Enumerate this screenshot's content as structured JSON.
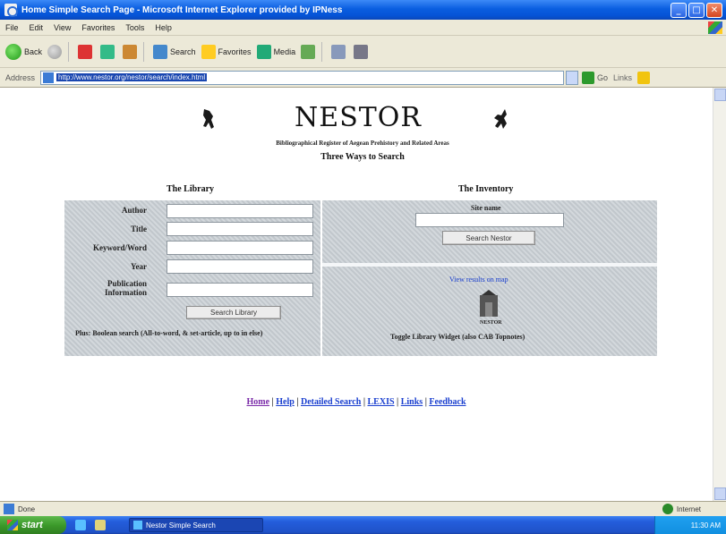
{
  "window": {
    "title": "Home Simple Search Page - Microsoft Internet Explorer provided by IPNess",
    "minimize": "_",
    "maximize": "□",
    "close": "✕"
  },
  "menu": [
    "File",
    "Edit",
    "View",
    "Favorites",
    "Tools",
    "Help"
  ],
  "toolbar": {
    "back": "Back",
    "search": "Search",
    "favorites": "Favorites",
    "media": "Media"
  },
  "address": {
    "label": "Address",
    "url": "http://www.nestor.org/nestor/search/index.html",
    "go": "Go",
    "links": "Links"
  },
  "page": {
    "title": "NESTOR",
    "subtitle": "Bibliographical Register of Aegean Prehistory and Related Areas",
    "search_kind": "Three Ways to Search",
    "library_heading": "The Library",
    "inventory_heading": "The Inventory",
    "fields": [
      {
        "label": "Author"
      },
      {
        "label": "Title"
      },
      {
        "label": "Keyword/Word"
      },
      {
        "label": "Year"
      },
      {
        "label": "Publication Information"
      }
    ],
    "library_button": "Search Library",
    "library_note": "Plus: Boolean search (All-to-word, & set-article, up to in else)",
    "site_label": "Site name",
    "inventory_button": "Search Nestor",
    "inventory_link": "View results on map",
    "logo_caption": "NESTOR",
    "inventory_note": "Toggle Library Widget (also CAB Topnotes)"
  },
  "footer": {
    "links": [
      "Home",
      "Help",
      "Detailed Search",
      "LEXIS",
      "Links",
      "Feedback"
    ],
    "separator": "|"
  },
  "status": {
    "text": "Done",
    "zone": "Internet"
  },
  "taskbar": {
    "start": "start",
    "task": "Nestor Simple Search",
    "clock": "11:30 AM"
  }
}
